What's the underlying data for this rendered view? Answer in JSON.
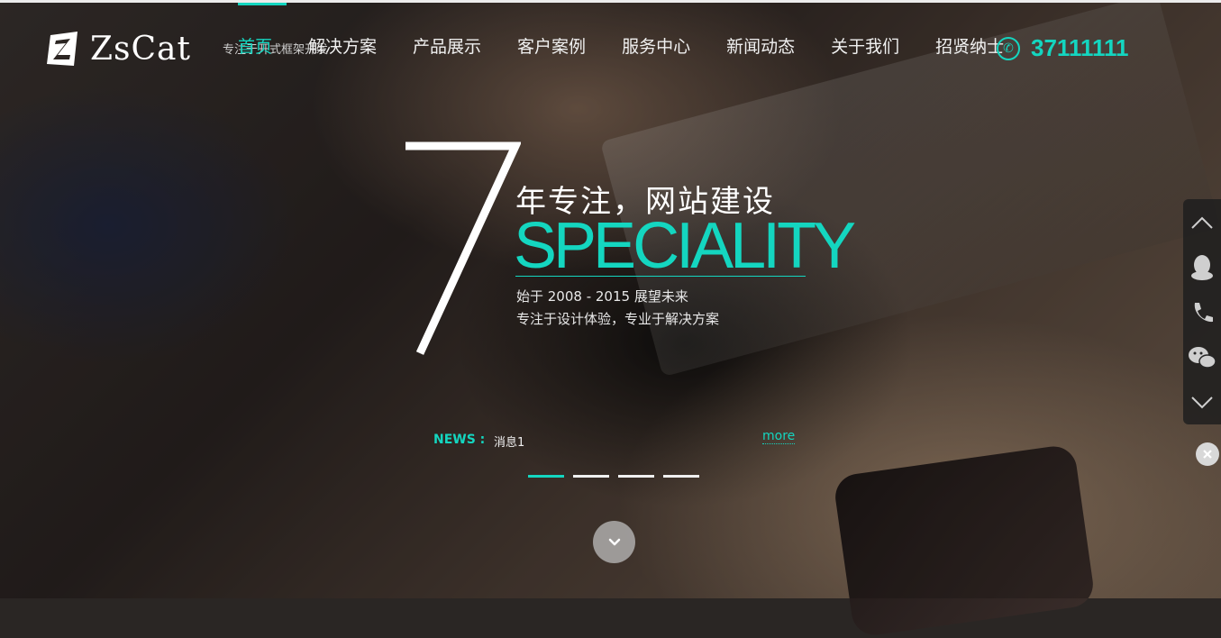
{
  "brand": {
    "logo_text": "ZsCat",
    "tagline": "专注于开式框架开发"
  },
  "nav": {
    "items": [
      {
        "label": "首页",
        "active": true
      },
      {
        "label": "解决方案",
        "active": false
      },
      {
        "label": "产品展示",
        "active": false
      },
      {
        "label": "客户案例",
        "active": false
      },
      {
        "label": "服务中心",
        "active": false
      },
      {
        "label": "新闻动态",
        "active": false
      },
      {
        "label": "关于我们",
        "active": false
      },
      {
        "label": "招贤纳士",
        "active": false
      }
    ]
  },
  "contact": {
    "phone": "37111111",
    "icon": "phone-icon"
  },
  "hero": {
    "big_number": "7",
    "headline": "年专注，网站建设",
    "specialty": "SPECIALITY",
    "subline1": "始于 2008 - 2015 展望未来",
    "subline2": "专注于设计体验，专业于解决方案"
  },
  "news": {
    "label": "NEWS :",
    "item": "消息1",
    "more": "more"
  },
  "slider": {
    "count": 4,
    "active_index": 0
  },
  "side_panel": {
    "icons": [
      "chevron-up-icon",
      "qq-icon",
      "phone-icon",
      "wechat-icon",
      "chevron-down-icon"
    ],
    "close_icon": "close-icon"
  },
  "colors": {
    "accent": "#14d6c0",
    "text": "#f0f0f0"
  }
}
